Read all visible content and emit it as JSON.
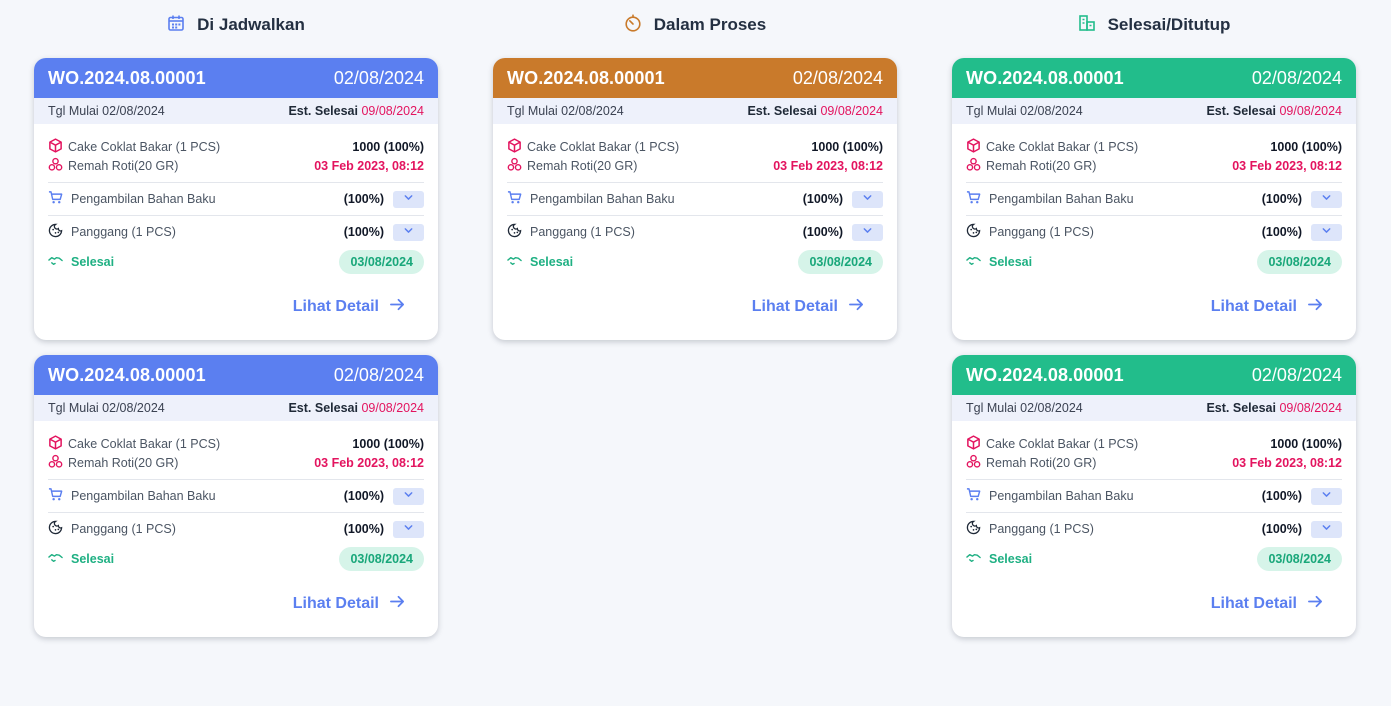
{
  "columns": [
    {
      "title": "Di Jadwalkan",
      "icon": "calendar-icon",
      "accent": "#5b7ff0",
      "cards": [
        {
          "wo": "WO.2024.08.00001",
          "date": "02/08/2024",
          "start_label": "Tgl Mulai 02/08/2024",
          "est_label": "Est. Selesai",
          "est_date": "09/08/2024",
          "product": "Cake Coklat Bakar (1 PCS)",
          "product_qty": "1000 (100%)",
          "material": "Remah Roti(20 GR)",
          "material_time": "03 Feb 2023, 08:12",
          "step1": "Pengambilan Bahan Baku",
          "step1_pct": "(100%)",
          "step2": "Panggang (1 PCS)",
          "step2_pct": "(100%)",
          "done_label": "Selesai",
          "done_date": "03/08/2024",
          "detail": "Lihat Detail"
        },
        {
          "wo": "WO.2024.08.00001",
          "date": "02/08/2024",
          "start_label": "Tgl Mulai 02/08/2024",
          "est_label": "Est. Selesai",
          "est_date": "09/08/2024",
          "product": "Cake Coklat Bakar (1 PCS)",
          "product_qty": "1000 (100%)",
          "material": "Remah Roti(20 GR)",
          "material_time": "03 Feb 2023, 08:12",
          "step1": "Pengambilan Bahan Baku",
          "step1_pct": "(100%)",
          "step2": "Panggang (1 PCS)",
          "step2_pct": "(100%)",
          "done_label": "Selesai",
          "done_date": "03/08/2024",
          "detail": "Lihat Detail"
        }
      ]
    },
    {
      "title": "Dalam Proses",
      "icon": "timer-icon",
      "accent": "#c97a2b",
      "cards": [
        {
          "wo": "WO.2024.08.00001",
          "date": "02/08/2024",
          "start_label": "Tgl Mulai 02/08/2024",
          "est_label": "Est. Selesai",
          "est_date": "09/08/2024",
          "product": "Cake Coklat Bakar (1 PCS)",
          "product_qty": "1000 (100%)",
          "material": "Remah Roti(20 GR)",
          "material_time": "03 Feb 2023, 08:12",
          "step1": "Pengambilan Bahan Baku",
          "step1_pct": "(100%)",
          "step2": "Panggang (1 PCS)",
          "step2_pct": "(100%)",
          "done_label": "Selesai",
          "done_date": "03/08/2024",
          "detail": "Lihat Detail"
        }
      ]
    },
    {
      "title": "Selesai/Ditutup",
      "icon": "building-icon",
      "accent": "#22bd8b",
      "cards": [
        {
          "wo": "WO.2024.08.00001",
          "date": "02/08/2024",
          "start_label": "Tgl Mulai 02/08/2024",
          "est_label": "Est. Selesai",
          "est_date": "09/08/2024",
          "product": "Cake Coklat Bakar (1 PCS)",
          "product_qty": "1000 (100%)",
          "material": "Remah Roti(20 GR)",
          "material_time": "03 Feb 2023, 08:12",
          "step1": "Pengambilan Bahan Baku",
          "step1_pct": "(100%)",
          "step2": "Panggang (1 PCS)",
          "step2_pct": "(100%)",
          "done_label": "Selesai",
          "done_date": "03/08/2024",
          "detail": "Lihat Detail"
        },
        {
          "wo": "WO.2024.08.00001",
          "date": "02/08/2024",
          "start_label": "Tgl Mulai 02/08/2024",
          "est_label": "Est. Selesai",
          "est_date": "09/08/2024",
          "product": "Cake Coklat Bakar (1 PCS)",
          "product_qty": "1000 (100%)",
          "material": "Remah Roti(20 GR)",
          "material_time": "03 Feb 2023, 08:12",
          "step1": "Pengambilan Bahan Baku",
          "step1_pct": "(100%)",
          "step2": "Panggang (1 PCS)",
          "step2_pct": "(100%)",
          "done_label": "Selesai",
          "done_date": "03/08/2024",
          "detail": "Lihat Detail"
        }
      ]
    }
  ]
}
